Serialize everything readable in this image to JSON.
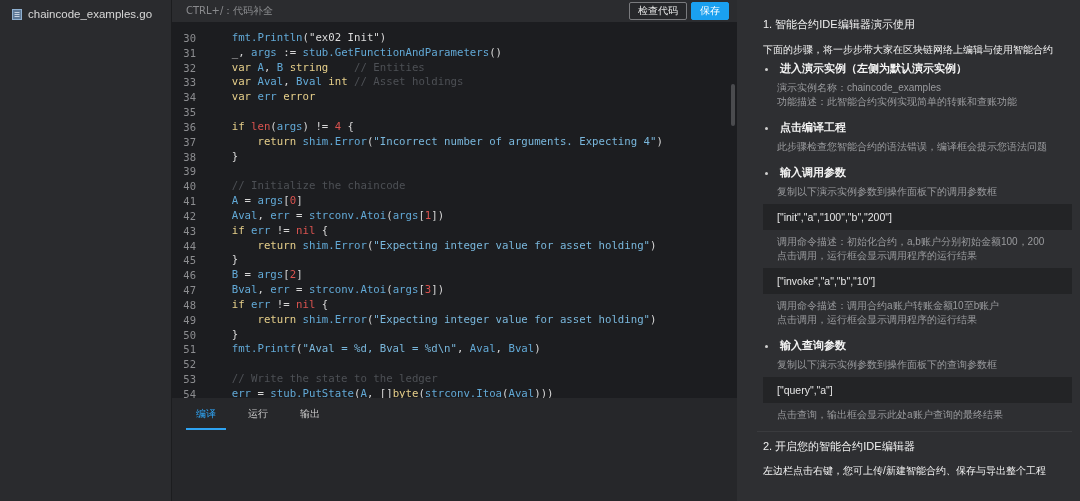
{
  "sidebar": {
    "files": [
      {
        "name": "chaincode_examples.go",
        "selected": false
      }
    ]
  },
  "editor": {
    "hint": "CTRL+/：代码补全",
    "buttons": [
      {
        "label": "检查代码",
        "kind": "outline"
      },
      {
        "label": "保存",
        "kind": "primary"
      }
    ],
    "lines": [
      {
        "number": "30",
        "tokens": [
          {
            "text": "    fmt.Println",
            "kind": "ident"
          },
          {
            "text": "(",
            "kind": "punct"
          },
          {
            "text": "\"ex02 Init\"",
            "kind": "plainstring"
          },
          {
            "text": ")",
            "kind": "punct"
          }
        ]
      },
      {
        "number": "31",
        "tokens": [
          {
            "text": "    _, ",
            "kind": "punct"
          },
          {
            "text": "args",
            "kind": "ident"
          },
          {
            "text": " := ",
            "kind": "punct"
          },
          {
            "text": "stub.GetFunctionAndParameters",
            "kind": "ident"
          },
          {
            "text": "()",
            "kind": "punct"
          }
        ]
      },
      {
        "number": "32",
        "tokens": [
          {
            "text": "    var ",
            "kind": "keyword"
          },
          {
            "text": "A",
            "kind": "ident"
          },
          {
            "text": ", ",
            "kind": "punct"
          },
          {
            "text": "B ",
            "kind": "ident"
          },
          {
            "text": "string",
            "kind": "keyword"
          },
          {
            "text": "    // Entities",
            "kind": "comment"
          }
        ]
      },
      {
        "number": "33",
        "tokens": [
          {
            "text": "    var ",
            "kind": "keyword"
          },
          {
            "text": "Aval",
            "kind": "ident"
          },
          {
            "text": ", ",
            "kind": "punct"
          },
          {
            "text": "Bval ",
            "kind": "ident"
          },
          {
            "text": "int ",
            "kind": "keyword"
          },
          {
            "text": "// Asset holdings",
            "kind": "comment"
          }
        ]
      },
      {
        "number": "34",
        "tokens": [
          {
            "text": "    var ",
            "kind": "keyword"
          },
          {
            "text": "err ",
            "kind": "ident"
          },
          {
            "text": "error",
            "kind": "keyword"
          }
        ]
      },
      {
        "number": "35"
      },
      {
        "number": "36",
        "tokens": [
          {
            "text": "    if ",
            "kind": "keyword"
          },
          {
            "text": "len",
            "kind": "builtin"
          },
          {
            "text": "(",
            "kind": "punct"
          },
          {
            "text": "args",
            "kind": "ident"
          },
          {
            "text": ") != ",
            "kind": "punct"
          },
          {
            "text": "4",
            "kind": "number"
          },
          {
            "text": " {",
            "kind": "punct"
          }
        ]
      },
      {
        "number": "37",
        "tokens": [
          {
            "text": "        return ",
            "kind": "keyword"
          },
          {
            "text": "shim.Error",
            "kind": "ident"
          },
          {
            "text": "(",
            "kind": "punct"
          },
          {
            "text": "\"Incorrect number of arguments. Expecting 4\"",
            "kind": "string"
          },
          {
            "text": ")",
            "kind": "punct"
          }
        ]
      },
      {
        "number": "38",
        "tokens": [
          {
            "text": "    }",
            "kind": "punct"
          }
        ]
      },
      {
        "number": "39"
      },
      {
        "number": "40",
        "tokens": [
          {
            "text": "    // Initialize the chaincode",
            "kind": "comment"
          }
        ]
      },
      {
        "number": "41",
        "tokens": [
          {
            "text": "    A",
            "kind": "ident"
          },
          {
            "text": " = ",
            "kind": "punct"
          },
          {
            "text": "args",
            "kind": "ident"
          },
          {
            "text": "[",
            "kind": "punct"
          },
          {
            "text": "0",
            "kind": "number"
          },
          {
            "text": "]",
            "kind": "punct"
          }
        ]
      },
      {
        "number": "42",
        "tokens": [
          {
            "text": "    Aval",
            "kind": "ident"
          },
          {
            "text": ", ",
            "kind": "punct"
          },
          {
            "text": "err",
            "kind": "ident"
          },
          {
            "text": " = ",
            "kind": "punct"
          },
          {
            "text": "strconv.Atoi",
            "kind": "ident"
          },
          {
            "text": "(",
            "kind": "punct"
          },
          {
            "text": "args",
            "kind": "ident"
          },
          {
            "text": "[",
            "kind": "punct"
          },
          {
            "text": "1",
            "kind": "number"
          },
          {
            "text": "])",
            "kind": "punct"
          }
        ]
      },
      {
        "number": "43",
        "tokens": [
          {
            "text": "    if ",
            "kind": "keyword"
          },
          {
            "text": "err",
            "kind": "ident"
          },
          {
            "text": " != ",
            "kind": "punct"
          },
          {
            "text": "nil",
            "kind": "builtin"
          },
          {
            "text": " {",
            "kind": "punct"
          }
        ]
      },
      {
        "number": "44",
        "tokens": [
          {
            "text": "        return ",
            "kind": "keyword"
          },
          {
            "text": "shim.Error",
            "kind": "ident"
          },
          {
            "text": "(",
            "kind": "punct"
          },
          {
            "text": "\"Expecting integer value for asset holding\"",
            "kind": "string"
          },
          {
            "text": ")",
            "kind": "punct"
          }
        ]
      },
      {
        "number": "45",
        "tokens": [
          {
            "text": "    }",
            "kind": "punct"
          }
        ]
      },
      {
        "number": "46",
        "tokens": [
          {
            "text": "    B",
            "kind": "ident"
          },
          {
            "text": " = ",
            "kind": "punct"
          },
          {
            "text": "args",
            "kind": "ident"
          },
          {
            "text": "[",
            "kind": "punct"
          },
          {
            "text": "2",
            "kind": "number"
          },
          {
            "text": "]",
            "kind": "punct"
          }
        ]
      },
      {
        "number": "47",
        "tokens": [
          {
            "text": "    Bval",
            "kind": "ident"
          },
          {
            "text": ", ",
            "kind": "punct"
          },
          {
            "text": "err",
            "kind": "ident"
          },
          {
            "text": " = ",
            "kind": "punct"
          },
          {
            "text": "strconv.Atoi",
            "kind": "ident"
          },
          {
            "text": "(",
            "kind": "punct"
          },
          {
            "text": "args",
            "kind": "ident"
          },
          {
            "text": "[",
            "kind": "punct"
          },
          {
            "text": "3",
            "kind": "number"
          },
          {
            "text": "])",
            "kind": "punct"
          }
        ]
      },
      {
        "number": "48",
        "tokens": [
          {
            "text": "    if ",
            "kind": "keyword"
          },
          {
            "text": "err",
            "kind": "ident"
          },
          {
            "text": " != ",
            "kind": "punct"
          },
          {
            "text": "nil",
            "kind": "builtin"
          },
          {
            "text": " {",
            "kind": "punct"
          }
        ]
      },
      {
        "number": "49",
        "tokens": [
          {
            "text": "        return ",
            "kind": "keyword"
          },
          {
            "text": "shim.Error",
            "kind": "ident"
          },
          {
            "text": "(",
            "kind": "punct"
          },
          {
            "text": "\"Expecting integer value for asset holding\"",
            "kind": "string"
          },
          {
            "text": ")",
            "kind": "punct"
          }
        ]
      },
      {
        "number": "50",
        "tokens": [
          {
            "text": "    }",
            "kind": "punct"
          }
        ]
      },
      {
        "number": "51",
        "tokens": [
          {
            "text": "    fmt.Printf",
            "kind": "ident"
          },
          {
            "text": "(",
            "kind": "punct"
          },
          {
            "text": "\"Aval = %d, Bval = %d\\n\"",
            "kind": "string"
          },
          {
            "text": ", ",
            "kind": "punct"
          },
          {
            "text": "Aval",
            "kind": "ident"
          },
          {
            "text": ", ",
            "kind": "punct"
          },
          {
            "text": "Bval",
            "kind": "ident"
          },
          {
            "text": ")",
            "kind": "punct"
          }
        ]
      },
      {
        "number": "52"
      },
      {
        "number": "53",
        "tokens": [
          {
            "text": "    // Write the state to the ledger",
            "kind": "comment"
          }
        ]
      },
      {
        "number": "54",
        "tokens": [
          {
            "text": "    err",
            "kind": "ident"
          },
          {
            "text": " = ",
            "kind": "punct"
          },
          {
            "text": "stub.PutState",
            "kind": "ident"
          },
          {
            "text": "(",
            "kind": "punct"
          },
          {
            "text": "A",
            "kind": "ident"
          },
          {
            "text": ", []",
            "kind": "punct"
          },
          {
            "text": "byte",
            "kind": "keyword"
          },
          {
            "text": "(",
            "kind": "punct"
          },
          {
            "text": "strconv.Itoa",
            "kind": "ident"
          },
          {
            "text": "(",
            "kind": "punct"
          },
          {
            "text": "Aval",
            "kind": "ident"
          },
          {
            "text": ")))",
            "kind": "punct"
          }
        ]
      }
    ]
  },
  "bottom_tabs": [
    {
      "label": "编译",
      "selected": true
    },
    {
      "label": "运行",
      "selected": false
    },
    {
      "label": "输出",
      "selected": false
    }
  ],
  "guide": {
    "sections": [
      {
        "heading": "1. 智能合约IDE编辑器演示使用",
        "intro": "下面的步骤，将一步步带大家在区块链网络上编辑与使用智能合约",
        "steps": [
          {
            "title": "进入演示实例（左侧为默认演示实例）",
            "blocks": [
              {
                "kind": "note",
                "lines": [
                  "演示实例名称：chaincode_examples",
                  "功能描述：此智能合约实例实现简单的转账和查账功能"
                ]
              }
            ]
          },
          {
            "title": "点击编译工程",
            "blocks": [
              {
                "kind": "note",
                "lines": [
                  "此步骤检查您智能合约的语法错误，编译框会提示您语法问题"
                ]
              }
            ]
          },
          {
            "title": "输入调用参数",
            "blocks": [
              {
                "kind": "note",
                "lines": [
                  "复制以下演示实例参数到操作面板下的调用参数框"
                ]
              },
              {
                "kind": "code",
                "lines": [
                  "[\"init\",\"a\",\"100\",\"b\",\"200\"]"
                ]
              },
              {
                "kind": "note",
                "lines": [
                  "调用命令描述：初始化合约，a,b账户分别初始金额100，200",
                  "点击调用，运行框会显示调用程序的运行结果"
                ]
              },
              {
                "kind": "code",
                "lines": [
                  "[\"invoke\",\"a\",\"b\",\"10\"]"
                ]
              },
              {
                "kind": "note",
                "lines": [
                  "调用命令描述：调用合约a账户转账金额10至b账户",
                  "点击调用，运行框会显示调用程序的运行结果"
                ]
              }
            ]
          },
          {
            "title": "输入查询参数",
            "blocks": [
              {
                "kind": "note",
                "lines": [
                  "复制以下演示实例参数到操作面板下的查询参数框"
                ]
              },
              {
                "kind": "code",
                "lines": [
                  "[\"query\",\"a\"]"
                ]
              },
              {
                "kind": "note",
                "lines": [
                  "点击查询，输出框会显示此处a账户查询的最终结果"
                ]
              }
            ]
          }
        ]
      },
      {
        "heading": "2. 开启您的智能合约IDE编辑器",
        "intro": "左边栏点击右键，您可上传/新建智能合约、保存与导出整个工程"
      }
    ]
  }
}
